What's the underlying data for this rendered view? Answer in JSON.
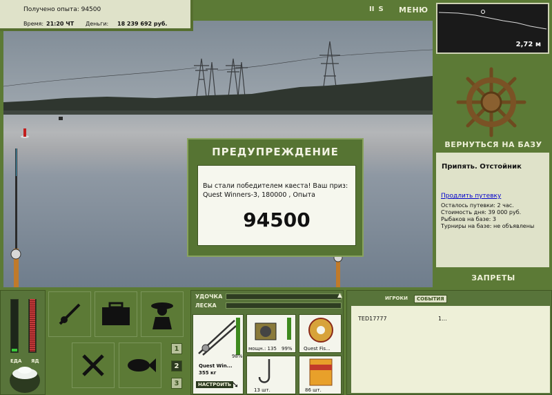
{
  "info": {
    "experience_label": "Получено опыта: 94500",
    "time_label": "Время:",
    "time_value": "21:20 ЧТ",
    "money_label": "Деньги:",
    "money_value": "18 239 692 руб."
  },
  "top_controls": {
    "pause": "II",
    "sound": "S",
    "menu": "МЕНЮ"
  },
  "depth": {
    "value": "2,72 м"
  },
  "right": {
    "back_to_base": "ВЕРНУТЬСЯ НА БАЗУ",
    "location_title": "Припять. Отстойник",
    "extend_pass": "Продлить путевку",
    "lines": [
      "Осталось путевки: 2 час.",
      "Стоимость дня: 39 000 руб.",
      "Рыбаков на базе: 3",
      "Турниры на базе: не объявлены"
    ],
    "bans": "ЗАПРЕТЫ"
  },
  "dialog": {
    "title": "ПРЕДУПРЕЖДЕНИЕ",
    "message": "Вы стали победителем квеста! Ваш приз: Quest Winners-3, 180000 , Опыта",
    "amount": "94500"
  },
  "gauges": {
    "food_label": "ЕДА",
    "poison_label": "ЯД",
    "food_level": 0.05,
    "poison_level": 1.0
  },
  "page_buttons": [
    "1",
    "2",
    "3"
  ],
  "tackle": {
    "rod_label": "УДОЧКА",
    "line_label": "ЛЕСКА",
    "rod_name": "Quest Win...",
    "rod_weight": "355 кг",
    "rod_percent": "98%",
    "setup_button": "НАСТРОИТЬ",
    "reel_caption": "мощн.: 135",
    "reel_percent": "99%",
    "line_caption": "Quest Fis...",
    "hook_caption": "13 шт.",
    "bait_caption": "86 шт."
  },
  "events": {
    "tabs": [
      "ИГРОКИ",
      "СОБЫТИЯ"
    ],
    "active_tab": 1,
    "rows": [
      {
        "name": "TED17777",
        "info": "1..."
      }
    ]
  },
  "colors": {
    "panel_green": "#5c7a36",
    "panel_cream": "#dfe2c9",
    "dialog_green": "#567433"
  }
}
